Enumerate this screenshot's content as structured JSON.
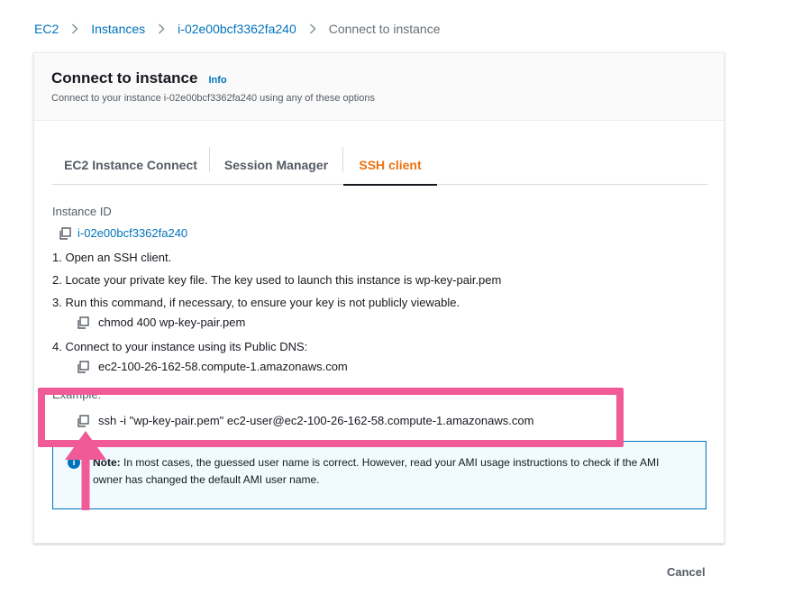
{
  "breadcrumb": {
    "items": [
      "EC2",
      "Instances",
      "i-02e00bcf3362fa240"
    ],
    "current": "Connect to instance"
  },
  "panel": {
    "title": "Connect to instance",
    "info": "Info",
    "description": "Connect to your instance i-02e00bcf3362fa240 using any of these options"
  },
  "tabs": [
    {
      "label": "EC2 Instance Connect",
      "selected": false
    },
    {
      "label": "Session Manager",
      "selected": false
    },
    {
      "label": "SSH client",
      "selected": true
    }
  ],
  "ssh": {
    "instance_id_label": "Instance ID",
    "instance_id": "i-02e00bcf3362fa240",
    "steps": [
      "1. Open an SSH client.",
      "2. Locate your private key file. The key used to launch this instance is wp-key-pair.pem",
      "3. Run this command, if necessary, to ensure your key is not publicly viewable.",
      "4. Connect to your instance using its Public DNS:"
    ],
    "chmod_command": "chmod 400 wp-key-pair.pem",
    "public_dns": "ec2-100-26-162-58.compute-1.amazonaws.com",
    "example_label": "Example:",
    "example_command": "ssh -i \"wp-key-pair.pem\" ec2-user@ec2-100-26-162-58.compute-1.amazonaws.com"
  },
  "note": {
    "bold": "Note:",
    "text": " In most cases, the guessed user name is correct. However, read your AMI usage instructions to check if the AMI owner has changed the default AMI user name."
  },
  "footer": {
    "cancel": "Cancel"
  },
  "colors": {
    "link": "#0073bb",
    "selected_tab": "#ec7211",
    "annotation": "#f05a96",
    "note_bg": "#f1faff"
  }
}
